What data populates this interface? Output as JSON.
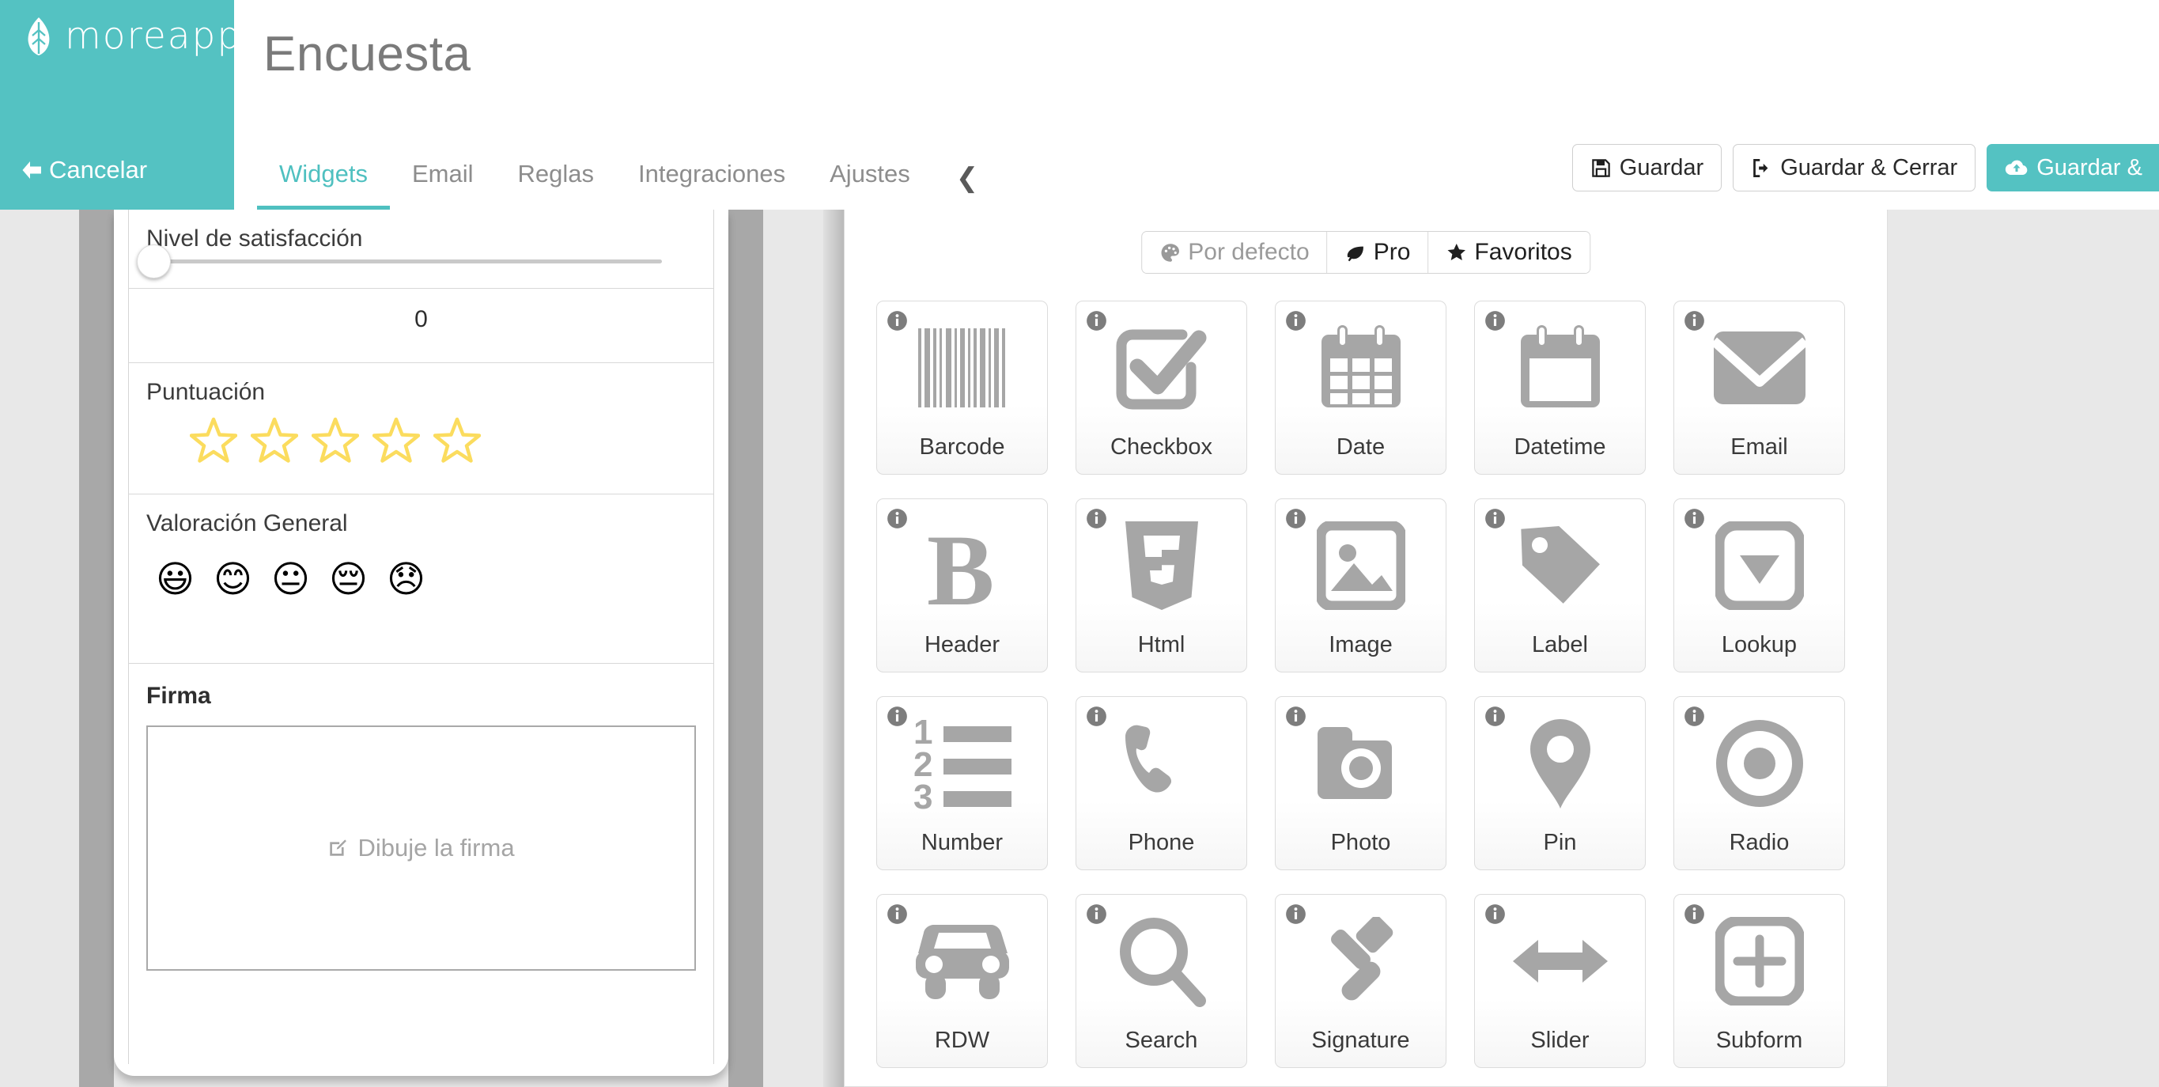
{
  "brand": {
    "name": "moreapp",
    "logo_icon": "leaf-icon"
  },
  "sidebar": {
    "cancel_label": "Cancelar",
    "cancel_icon": "arrow-left-icon"
  },
  "header": {
    "title": "Encuesta",
    "tabs": [
      {
        "label": "Widgets",
        "active": true
      },
      {
        "label": "Email",
        "active": false
      },
      {
        "label": "Reglas",
        "active": false
      },
      {
        "label": "Integraciones",
        "active": false
      },
      {
        "label": "Ajustes",
        "active": false
      }
    ],
    "collapse_icon": "chevron-left-icon",
    "actions": [
      {
        "label": "Guardar",
        "icon": "floppy-disk-icon",
        "primary": false
      },
      {
        "label": "Guardar & Cerrar",
        "icon": "sign-out-icon",
        "primary": false
      },
      {
        "label": "Guardar &",
        "icon": "cloud-upload-icon",
        "primary": true
      }
    ]
  },
  "accent_color": "#54c2c2",
  "preview": {
    "widgets": [
      {
        "type": "slider",
        "label": "Nivel de satisfacción",
        "value": 0
      },
      {
        "type": "value",
        "value": "0"
      },
      {
        "type": "stars",
        "label": "Puntuación",
        "count": 5,
        "filled": 0,
        "star_color": "#fbdc5e"
      },
      {
        "type": "smiley",
        "label": "Valoración General",
        "faces": [
          "😃",
          "😊",
          "😐",
          "😔",
          "😞"
        ]
      },
      {
        "type": "signature",
        "label": "Firma",
        "placeholder": "Dibuje la firma",
        "placeholder_icon": "pencil-square-icon"
      }
    ]
  },
  "catalog": {
    "categories": [
      {
        "label": "Por defecto",
        "icon": "palette-icon",
        "active": false
      },
      {
        "label": "Pro",
        "icon": "leaf-icon",
        "active": false
      },
      {
        "label": "Favoritos",
        "icon": "star-icon",
        "active": false
      }
    ],
    "info_icon": "info-circle-icon",
    "widgets": [
      {
        "label": "Barcode",
        "icon": "barcode-icon"
      },
      {
        "label": "Checkbox",
        "icon": "checkbox-icon"
      },
      {
        "label": "Date",
        "icon": "calendar-icon"
      },
      {
        "label": "Datetime",
        "icon": "calendar-blank-icon"
      },
      {
        "label": "Email",
        "icon": "envelope-icon"
      },
      {
        "label": "Header",
        "icon": "bold-b-icon"
      },
      {
        "label": "Html",
        "icon": "html5-icon"
      },
      {
        "label": "Image",
        "icon": "picture-icon"
      },
      {
        "label": "Label",
        "icon": "tag-icon"
      },
      {
        "label": "Lookup",
        "icon": "dropdown-icon"
      },
      {
        "label": "Number",
        "icon": "ordered-list-icon"
      },
      {
        "label": "Phone",
        "icon": "phone-icon"
      },
      {
        "label": "Photo",
        "icon": "camera-icon"
      },
      {
        "label": "Pin",
        "icon": "map-pin-icon"
      },
      {
        "label": "Radio",
        "icon": "radio-button-icon"
      },
      {
        "label": "RDW",
        "icon": "car-icon"
      },
      {
        "label": "Search",
        "icon": "magnifier-icon"
      },
      {
        "label": "Signature",
        "icon": "gavel-icon"
      },
      {
        "label": "Slider",
        "icon": "arrows-horizontal-icon"
      },
      {
        "label": "Subform",
        "icon": "plus-square-icon"
      }
    ]
  }
}
